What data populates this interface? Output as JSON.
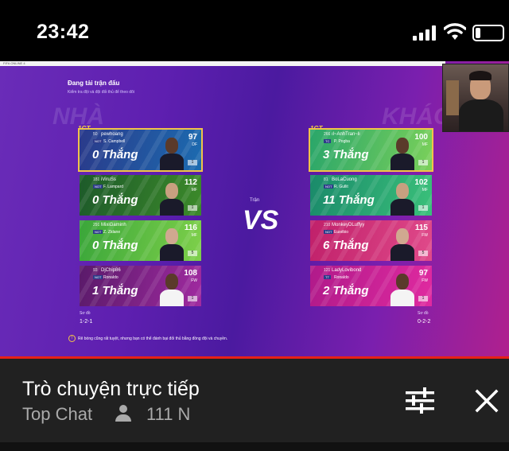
{
  "status_bar": {
    "time": "23:42",
    "battery_level": 0.2
  },
  "game": {
    "window_label": "FIFA ONLINE 4",
    "title": "Đang tải trận đấu",
    "subtitle": "Kiểm tra đội và đội đối thủ để theo dõi",
    "home_label": "NHÀ",
    "away_label": "KHÁCH",
    "vs_label": "Trận",
    "vs": "VS",
    "badge": "1GT",
    "home": {
      "form_label": "Sơ đồ",
      "form": "1-2-1",
      "cards": [
        {
          "ovr": "50",
          "user": "pewhoang",
          "flag": "NOT",
          "player": "S. Campbell",
          "wins": "0 Thắng",
          "rating": "97",
          "pos": "DF",
          "lv": "1",
          "colors": [
            "#2a3a8a",
            "#1c6bb0"
          ]
        },
        {
          "ovr": "181",
          "user": "iViruSs",
          "flag": "NOT",
          "player": "F. Lampard",
          "wins": "0 Thắng",
          "rating": "112",
          "pos": "MF",
          "lv": "1",
          "colors": [
            "#1d5a2a",
            "#3c8a2a"
          ]
        },
        {
          "ovr": "291",
          "user": "MixiGaminh",
          "flag": "NOT",
          "player": "Z. Zidane",
          "wins": "0 Thắng",
          "rating": "116",
          "pos": "MF",
          "lv": "5",
          "colors": [
            "#3aa63a",
            "#7ed04a"
          ]
        },
        {
          "ovr": "93",
          "user": "DjChip86",
          "flag": "NOT",
          "player": "Ronaldo",
          "wins": "1 Thắng",
          "rating": "108",
          "pos": "FW",
          "lv": "1",
          "colors": [
            "#5a1a6a",
            "#a02aa0"
          ]
        }
      ]
    },
    "away": {
      "form_label": "Sơ đồ",
      "form": "0-2-2",
      "cards": [
        {
          "ovr": "266",
          "user": "ıl~AnhTran~lı",
          "flag": "TC",
          "player": "P. Pogba",
          "wins": "3 Thắng",
          "rating": "100",
          "pos": "MF",
          "lv": "1",
          "colors": [
            "#2aa66a",
            "#7ad05a"
          ]
        },
        {
          "ovr": "81",
          "user": "BoLaCuong",
          "flag": "NOT",
          "player": "R. Gullit",
          "wins": "11 Thắng",
          "rating": "102",
          "pos": "MF",
          "lv": "1",
          "colors": [
            "#1a8a6a",
            "#3ac07a"
          ]
        },
        {
          "ovr": "210",
          "user": "MonkeyDLuffyy",
          "flag": "NOT",
          "player": "Eusébio",
          "wins": "6 Thắng",
          "rating": "115",
          "pos": "FW",
          "lv": "5",
          "colors": [
            "#c0206a",
            "#e04a8a"
          ]
        },
        {
          "ovr": "121",
          "user": "LadyLovibond",
          "flag": "TT",
          "player": "Ronaldo",
          "wins": "2 Thắng",
          "rating": "97",
          "pos": "FW",
          "lv": "1",
          "colors": [
            "#b01a8a",
            "#e02aa0"
          ]
        }
      ]
    },
    "tip": "Rê bóng cũng rất tuyệt, nhưng bạn có thể đánh bại đối thủ bằng đồng đội và chuyền."
  },
  "chat": {
    "title": "Trò chuyện trực tiếp",
    "mode": "Top Chat",
    "viewers": "111 N",
    "icons": {
      "viewers": "person-icon",
      "filter": "sliders-icon",
      "close": "close-icon"
    }
  }
}
